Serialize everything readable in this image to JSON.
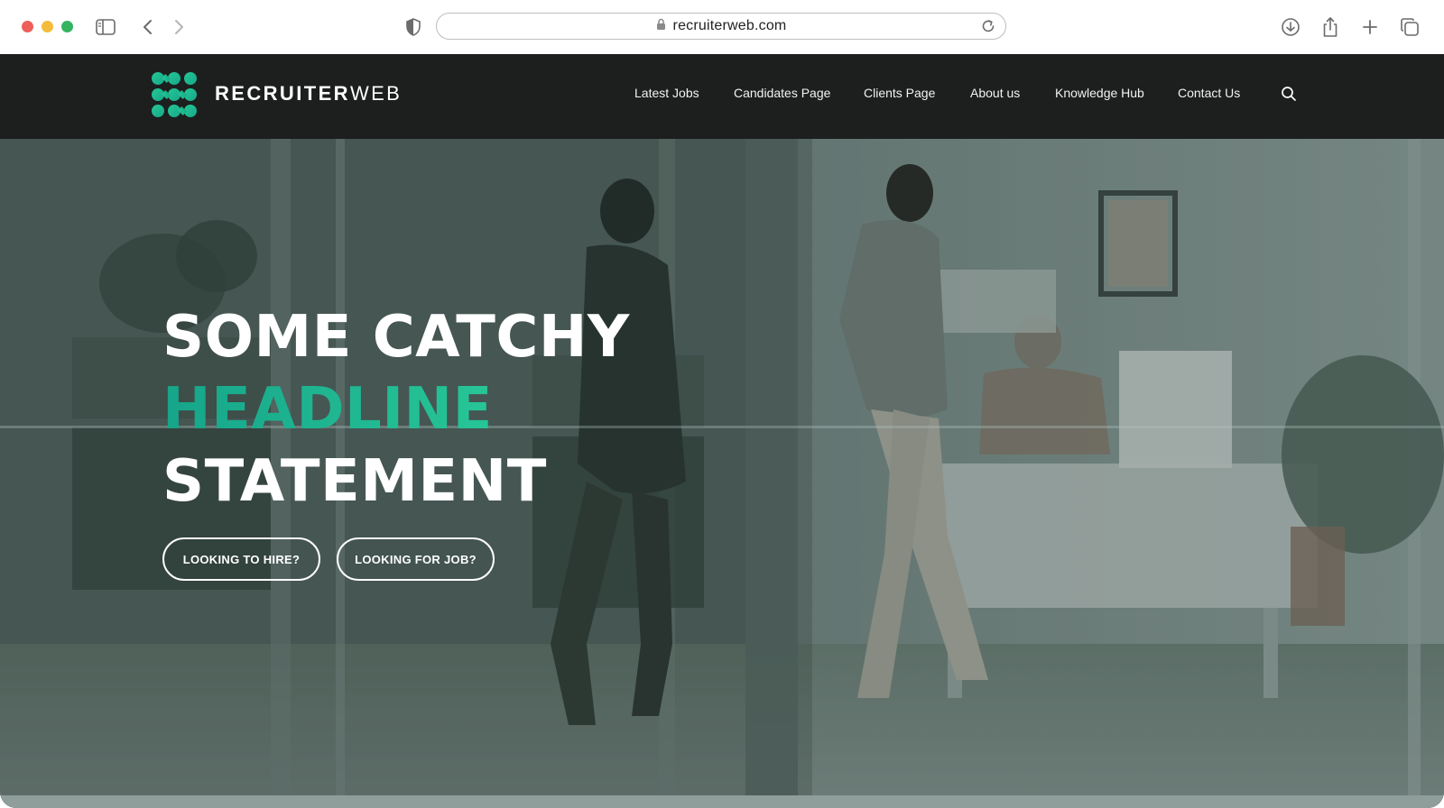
{
  "browser": {
    "url": "recruiterweb.com",
    "icons": {
      "sidebar": "sidebar-toggle-icon",
      "back": "chevron-left-icon",
      "forward": "chevron-right-icon",
      "privacy": "shield-icon",
      "lock": "lock-icon",
      "reload": "reload-icon",
      "download": "download-icon",
      "share": "share-icon",
      "new_tab": "plus-icon",
      "tabs": "tab-overview-icon"
    }
  },
  "site": {
    "brand": {
      "part1": "RECRUITER",
      "part2": "WEB"
    },
    "colors": {
      "nav_bg": "#1c1f1e",
      "accent_start": "#16a58a",
      "accent_end": "#2ed39c"
    },
    "nav": [
      {
        "label": "Latest Jobs"
      },
      {
        "label": "Candidates Page"
      },
      {
        "label": "Clients Page"
      },
      {
        "label": "About us"
      },
      {
        "label": "Knowledge Hub"
      },
      {
        "label": "Contact Us"
      }
    ],
    "hero": {
      "line1": "SOME CATCHY",
      "line2": "HEADLINE",
      "line3": "STATEMENT",
      "cta_hire": "LOOKING TO HIRE?",
      "cta_job": "LOOKING FOR JOB?"
    }
  }
}
